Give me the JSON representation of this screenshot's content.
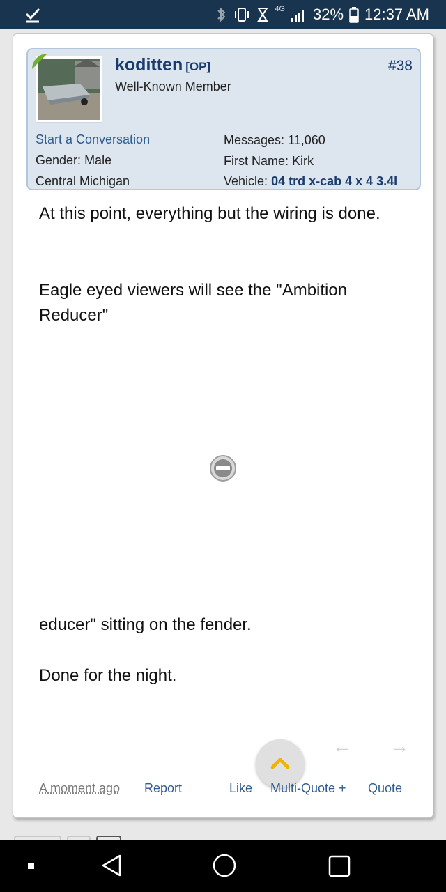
{
  "status_bar": {
    "battery_percent": "32%",
    "network_label": "4G",
    "time": "12:37 AM"
  },
  "post": {
    "username": "koditten",
    "op_tag": "[OP]",
    "user_title": "Well-Known Member",
    "post_number": "#38",
    "start_conversation": "Start a Conversation",
    "gender_label": "Gender:",
    "gender_value": "Male",
    "location": "Central Michigan",
    "messages_label": "Messages:",
    "messages_value": "11,060",
    "first_name_label": "First Name:",
    "first_name_value": "Kirk",
    "vehicle_label": "Vehicle:",
    "vehicle_value": "04 trd x-cab 4 x 4 3.4l",
    "message_lines": [
      "At this point, everything but the wiring is done.",
      "Eagle eyed viewers will see the \"Ambition Reducer\"",
      "educer\" sitting on the fender.",
      "Done for the night."
    ],
    "timestamp": "A moment ago",
    "actions": {
      "report": "Report",
      "like": "Like",
      "multi_quote": "Multi-Quote +",
      "quote": "Quote"
    }
  },
  "colors": {
    "status_bar_bg": "#19344f",
    "username": "#1a3c6b",
    "link": "#2e5c8e",
    "user_block_bg": "#dde5ee"
  }
}
